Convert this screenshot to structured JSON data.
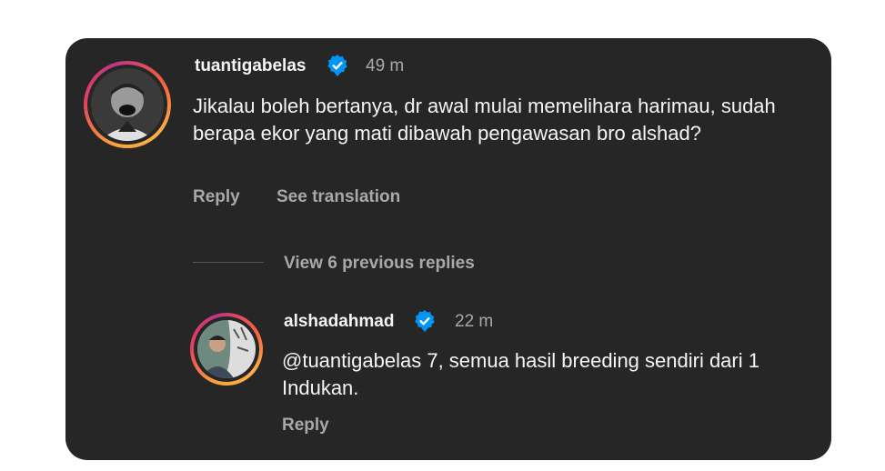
{
  "comment": {
    "username": "tuantigabelas",
    "time": "49 m",
    "text": "Jikalau boleh bertanya, dr awal mulai memelihara harimau, sudah berapa ekor yang mati dibawah pengawasan bro alshad?",
    "reply_label": "Reply",
    "translate_label": "See translation",
    "view_replies_label": "View 6 previous replies"
  },
  "reply": {
    "username": "alshadahmad",
    "time": "22 m",
    "text": "@tuantigabelas 7, semua hasil breeding sendiri dari 1 Indukan.",
    "reply_label": "Reply"
  },
  "colors": {
    "card_bg": "#262626",
    "verified": "#0095f6",
    "muted_text": "#a8a8a8"
  }
}
